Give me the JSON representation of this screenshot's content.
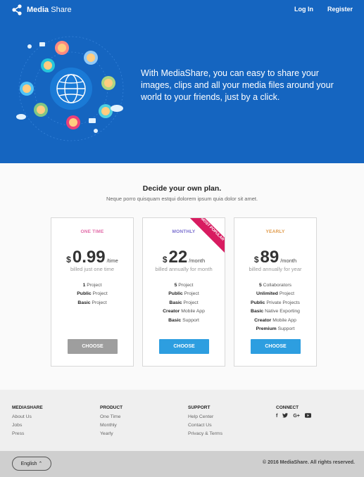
{
  "header": {
    "brand_bold": "Media",
    "brand_rest": "Share",
    "nav": {
      "login": "Log In",
      "register": "Register"
    }
  },
  "hero": {
    "text": "With MediaShare, you can easy to share your images, clips and all your media files around your world to your friends, just by a click."
  },
  "plans": {
    "title": "Decide your own plan.",
    "subtitle": "Neque porro quisquam estqui dolorem ipsum quia dolor sit amet.",
    "cards": [
      {
        "name": "ONE TIME",
        "name_color": "#e26ba8",
        "currency": "$",
        "amount": "0.99",
        "per": "/time",
        "billed": "billed just one time",
        "features": [
          {
            "bold": "1",
            "rest": " Project"
          },
          {
            "bold": "Public",
            "rest": " Project"
          },
          {
            "bold": "Basic",
            "rest": " Project"
          }
        ],
        "button": "CHOOSE",
        "button_color": "#9e9e9e"
      },
      {
        "name": "MONTHLY",
        "name_color": "#7a6fcf",
        "currency": "$",
        "amount": "22",
        "per": "/month",
        "billed": "billed annually for month",
        "ribbon": "MOST POPULAR",
        "features": [
          {
            "bold": "5",
            "rest": " Project"
          },
          {
            "bold": "Public",
            "rest": " Project"
          },
          {
            "bold": "Basic",
            "rest": " Project"
          },
          {
            "bold": "Creator",
            "rest": " Mobile App"
          },
          {
            "bold": "Basic",
            "rest": " Support"
          }
        ],
        "button": "CHOOSE",
        "button_color": "#2d9ee0"
      },
      {
        "name": "YEARLY",
        "name_color": "#e09a4a",
        "currency": "$",
        "amount": "89",
        "per": "/month",
        "billed": "billed annually for year",
        "features": [
          {
            "bold": "5",
            "rest": " Collaborators"
          },
          {
            "bold": "Unlimited",
            "rest": " Project"
          },
          {
            "bold": "Public",
            "rest": " Private Projects"
          },
          {
            "bold": "Basic",
            "rest": " Native Exporting"
          },
          {
            "bold": "Creator",
            "rest": " Mobile App"
          },
          {
            "bold": "Premium",
            "rest": " Support"
          }
        ],
        "button": "CHOOSE",
        "button_color": "#2d9ee0"
      }
    ]
  },
  "footer": {
    "columns": [
      {
        "title": "MEDIASHARE",
        "links": [
          "About Us",
          "Jobs",
          "Press"
        ]
      },
      {
        "title": "PRODUCT",
        "links": [
          "One Time",
          "Monthly",
          "Yearly"
        ]
      },
      {
        "title": "SUPPORT",
        "links": [
          "Help Center",
          "Contact Us",
          "Privacy & Terms"
        ]
      }
    ],
    "connect": {
      "title": "CONNECT",
      "icons": [
        {
          "name": "facebook-icon",
          "glyph": "f"
        },
        {
          "name": "twitter-icon",
          "glyph": "🐦"
        },
        {
          "name": "google-plus-icon",
          "glyph": "G+"
        },
        {
          "name": "youtube-icon",
          "glyph": "▶"
        }
      ]
    },
    "language": "English ⌃",
    "copyright": "© 2016 MediaShare. All rights reserved."
  },
  "colors": {
    "hero_bg": "#1565c0",
    "primary_button": "#2d9ee0",
    "ribbon": "#d81b60"
  }
}
